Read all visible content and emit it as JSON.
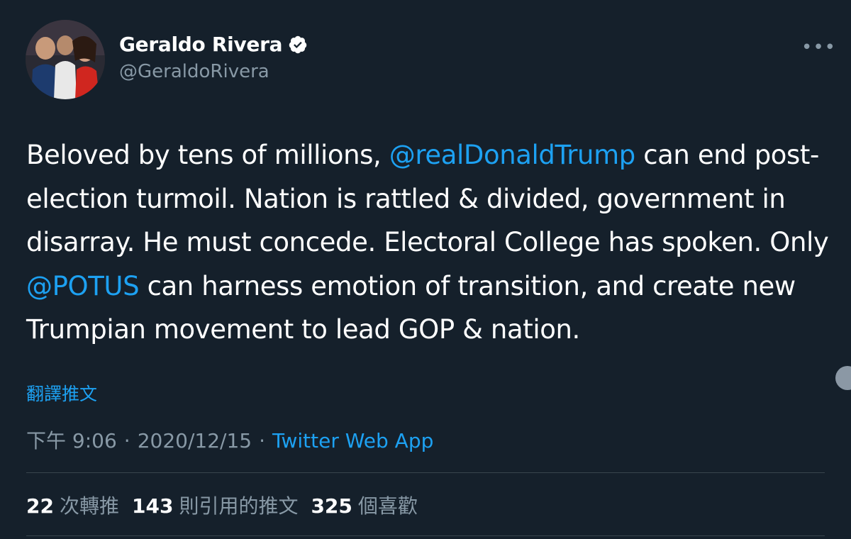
{
  "author": {
    "name": "Geraldo Rivera",
    "handle": "@GeraldoRivera"
  },
  "tweet": {
    "segments": [
      {
        "text": "Beloved by tens of millions, ",
        "type": "text"
      },
      {
        "text": "@realDonaldTrump",
        "type": "mention"
      },
      {
        "text": " can end post-election turmoil. Nation is rattled & divided, government in disarray. He must concede. Electoral College has spoken. Only ",
        "type": "text"
      },
      {
        "text": "@POTUS",
        "type": "mention"
      },
      {
        "text": " can harness emotion of transition, and create new Trumpian movement to lead GOP & nation.",
        "type": "text"
      }
    ],
    "translate_label": "翻譯推文",
    "time": "下午 9:06",
    "date": "2020/12/15",
    "separator": "·",
    "source": "Twitter Web App"
  },
  "stats": {
    "retweets": {
      "count": "22",
      "label": "次轉推"
    },
    "quotes": {
      "count": "143",
      "label": "則引用的推文"
    },
    "likes": {
      "count": "325",
      "label": "個喜歡"
    }
  },
  "icons": {
    "verified": "verified-badge-icon",
    "more": "more-options-icon"
  },
  "colors": {
    "background": "#15202b",
    "accent": "#1da1f2",
    "secondary_text": "#8899a6",
    "divider": "#38444d"
  }
}
